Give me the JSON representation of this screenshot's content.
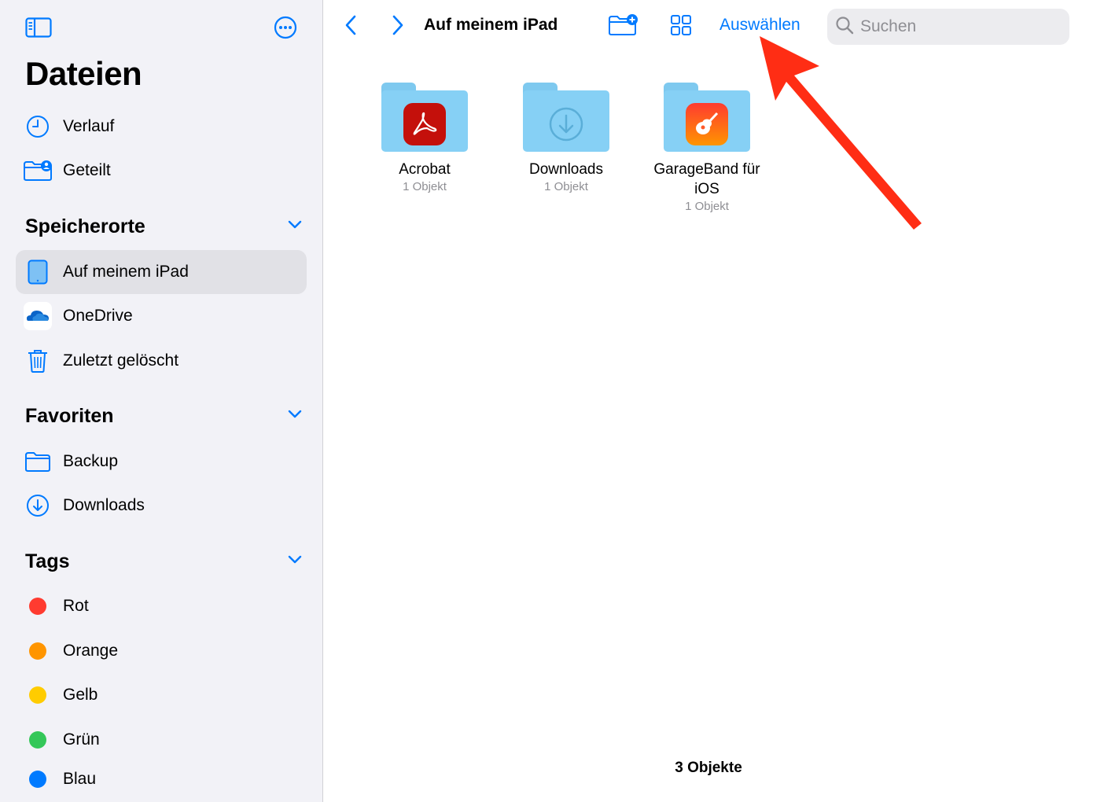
{
  "sidebar": {
    "title": "Dateien",
    "top_items": [
      {
        "label": "Verlauf",
        "icon": "clock-icon"
      },
      {
        "label": "Geteilt",
        "icon": "shared-folder-icon"
      }
    ],
    "sections": {
      "locations": {
        "title": "Speicherorte",
        "items": [
          {
            "label": "Auf meinem iPad",
            "icon": "ipad-icon",
            "active": true
          },
          {
            "label": "OneDrive",
            "icon": "onedrive-icon"
          },
          {
            "label": "Zuletzt gelöscht",
            "icon": "trash-icon"
          }
        ]
      },
      "favorites": {
        "title": "Favoriten",
        "items": [
          {
            "label": "Backup",
            "icon": "folder-icon"
          },
          {
            "label": "Downloads",
            "icon": "download-circle-icon"
          }
        ]
      },
      "tags": {
        "title": "Tags",
        "items": [
          {
            "label": "Rot",
            "color": "#ff3b30"
          },
          {
            "label": "Orange",
            "color": "#ff9500"
          },
          {
            "label": "Gelb",
            "color": "#ffcc00"
          },
          {
            "label": "Grün",
            "color": "#34c759"
          },
          {
            "label": "Blau",
            "color": "#007aff"
          }
        ]
      }
    }
  },
  "toolbar": {
    "path_title": "Auf meinem iPad",
    "select_label": "Auswählen",
    "search_placeholder": "Suchen"
  },
  "files": [
    {
      "name": "Acrobat",
      "sub": "1 Objekt",
      "badge": "acrobat-icon"
    },
    {
      "name": "Downloads",
      "sub": "1 Objekt",
      "badge": "download-arrow-icon"
    },
    {
      "name": "GarageBand für iOS",
      "sub": "1 Objekt",
      "badge": "garageband-icon"
    }
  ],
  "footer": {
    "count": "3 Objekte"
  },
  "colors": {
    "accent": "#007aff",
    "annotation_arrow": "#ff2d14"
  }
}
